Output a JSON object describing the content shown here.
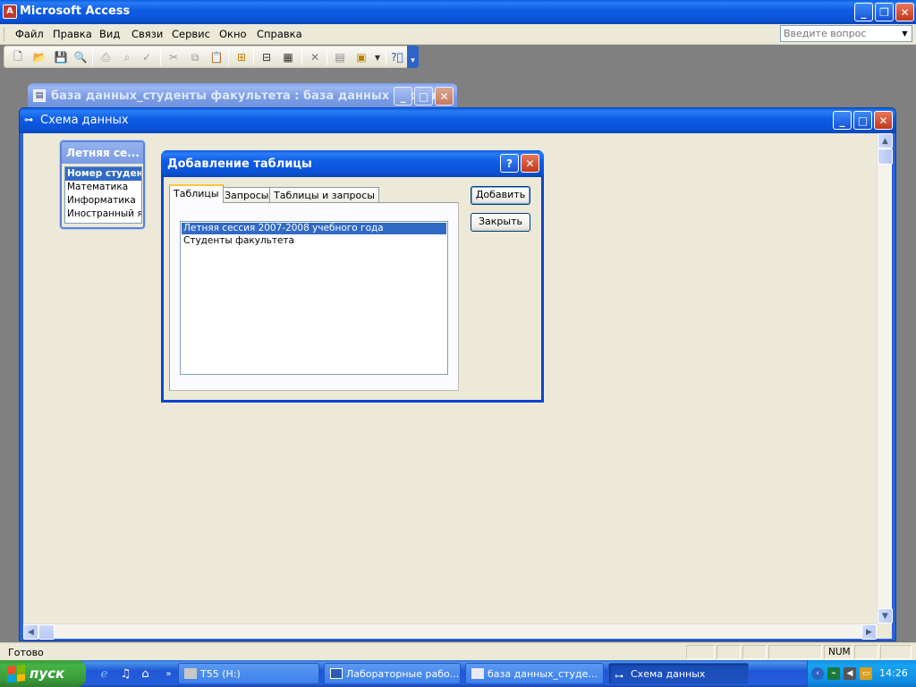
{
  "app": {
    "title": "Microsoft Access"
  },
  "menu": {
    "items": [
      "Файл",
      "Правка",
      "Вид",
      "Связи",
      "Сервис",
      "Окно",
      "Справка"
    ],
    "help_placeholder": "Введите вопрос"
  },
  "db_window": {
    "title": "база данных_студенты факультета : база данных (форм..."
  },
  "schema_window": {
    "title": "Схема данных"
  },
  "table_box": {
    "title": "Летняя се...",
    "fields": [
      "Номер студенче",
      "Математика",
      "Информатика",
      "Иностранный яз"
    ]
  },
  "dialog": {
    "title": "Добавление таблицы",
    "tabs": [
      "Таблицы",
      "Запросы",
      "Таблицы и запросы"
    ],
    "active_tab": "Таблицы",
    "list": [
      "Летняя сессия 2007-2008 учебного года",
      "Студенты факультета"
    ],
    "selected_item": "Летняя сессия 2007-2008 учебного года",
    "add_button": "Добавить",
    "close_button": "Закрыть",
    "help_glyph": "?"
  },
  "status": {
    "text": "Готово",
    "num": "NUM"
  },
  "taskbar": {
    "start_label": "пуск",
    "tasks": [
      "T55 (H:)",
      "Лабораторные рабо...",
      "база данных_студе...",
      "Схема данных"
    ],
    "active_task": "Схема данных",
    "clock": "14:26"
  },
  "colors": {
    "title_blue": "#0a53d8",
    "selection": "#316ac5",
    "face": "#ece9d8",
    "start_green": "#3a9c3a",
    "close_red": "#c2381b"
  }
}
